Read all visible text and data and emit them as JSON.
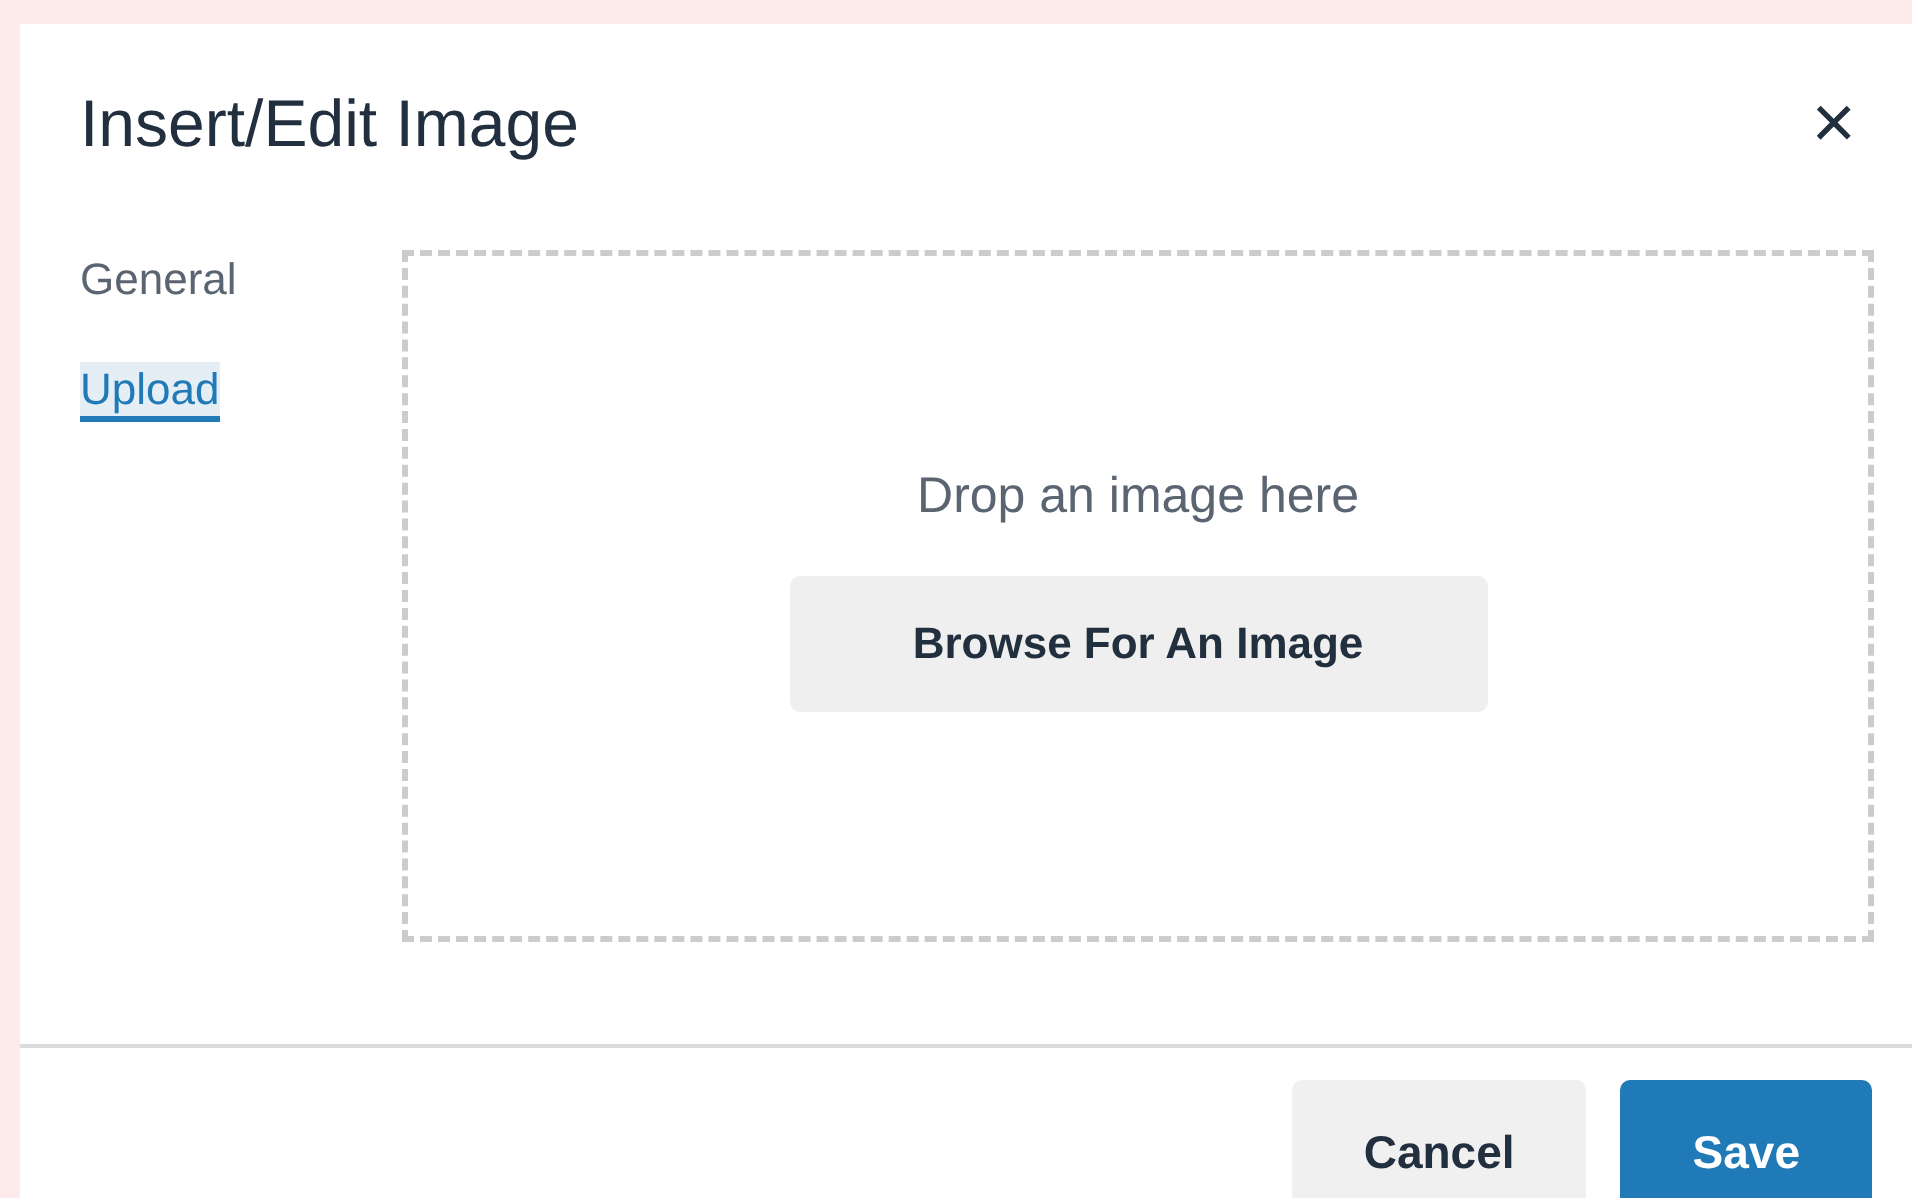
{
  "dialog": {
    "title": "Insert/Edit Image",
    "close": "×"
  },
  "tabs": [
    {
      "label": "General",
      "selected": false
    },
    {
      "label": "Upload",
      "selected": true
    }
  ],
  "dropzone": {
    "text": "Drop an image here",
    "button": "Browse For An Image"
  },
  "footer": {
    "buttons": [
      {
        "label": "Cancel",
        "kind": "secondary"
      },
      {
        "label": "Save",
        "kind": "primary"
      }
    ]
  }
}
